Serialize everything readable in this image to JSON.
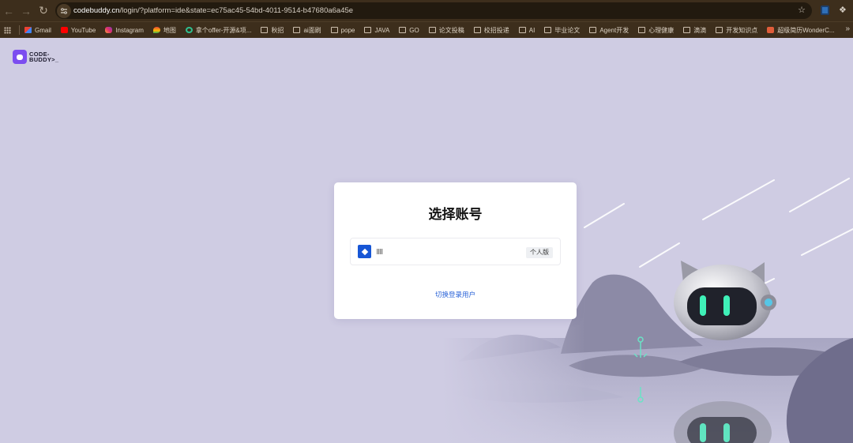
{
  "browser": {
    "url_host": "codebuddy.cn",
    "url_path": "/login/?platform=ide&state=ec75ac45-54bd-4011-9514-b47680a6a45e",
    "bookmarks": [
      {
        "label": "Gmail",
        "icon": "gmail-icon"
      },
      {
        "label": "YouTube",
        "icon": "youtube-icon"
      },
      {
        "label": "Instagram",
        "icon": "instagram-icon"
      },
      {
        "label": "地图",
        "icon": "maps-icon"
      },
      {
        "label": "拿个offer-开源&项...",
        "icon": "site-icon"
      },
      {
        "label": "秋招",
        "icon": "folder-icon"
      },
      {
        "label": "ai面刷",
        "icon": "folder-icon"
      },
      {
        "label": "pope",
        "icon": "folder-icon"
      },
      {
        "label": "JAVA",
        "icon": "folder-icon"
      },
      {
        "label": "GO",
        "icon": "folder-icon"
      },
      {
        "label": "论文投稿",
        "icon": "folder-icon"
      },
      {
        "label": "校招投递",
        "icon": "folder-icon"
      },
      {
        "label": "AI",
        "icon": "folder-icon"
      },
      {
        "label": "毕业论文",
        "icon": "folder-icon"
      },
      {
        "label": "Agent开发",
        "icon": "folder-icon"
      },
      {
        "label": "心理健康",
        "icon": "folder-icon"
      },
      {
        "label": "滴滴",
        "icon": "folder-icon"
      },
      {
        "label": "开发知识点",
        "icon": "folder-icon"
      },
      {
        "label": "超级简历WonderC...",
        "icon": "site-icon"
      }
    ]
  },
  "page": {
    "logo_text": "CODE-BUDDY>_",
    "card": {
      "title": "选择账号",
      "account": {
        "plan_badge": "个人版"
      },
      "switch_link": "切换登录用户"
    }
  },
  "colors": {
    "page_bg": "#cfcce3",
    "link": "#2a63d8",
    "brand": "#7c4df0",
    "chrome_bg": "#3d2e1c"
  }
}
